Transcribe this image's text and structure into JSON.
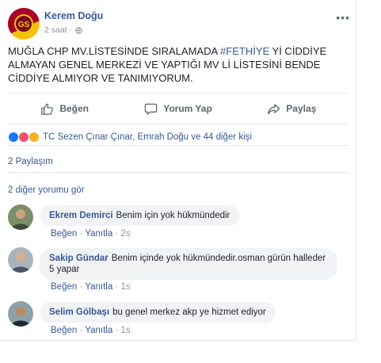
{
  "post": {
    "author": "Kerem Doğu",
    "time": "2 saat ·",
    "more": "•••",
    "text_before": "MUĞLA CHP MV.LİSTESİNDE SIRALAMADA ",
    "hashtag": "#FETHİYE",
    "text_after": " Yİ CİDDİYE ALMAYAN GENEL MERKEZİ VE YAPTIĞI MV Lİ LİSTESİNİ BENDE CİDDİYE ALMIYOR VE TANIMIYORUM."
  },
  "actions": {
    "like": "Beğen",
    "comment": "Yorum Yap",
    "share": "Paylaş"
  },
  "reactions": {
    "text": "TC Sezen Çınar Çınar, Emrah Doğu ve 44 diğer kişi"
  },
  "shares": "2 Paylaşım",
  "more_comments": "2 diğer yorumu gör",
  "comments": [
    {
      "author": "Ekrem Demirci",
      "text": "Benim için yok hükmündedir",
      "like": "Beğen",
      "reply": "Yanıtla",
      "time": "2s"
    },
    {
      "author": "Sakip Gündar",
      "text": "Benim içinde yok hükmündedir.osman gürün halleder 5 yapar",
      "like": "Beğen",
      "reply": "Yanıtla",
      "time": "1s"
    },
    {
      "author": "Selim Gölbaşı",
      "text": "bu genel merkez akp ye hizmet ediyor",
      "like": "Beğen",
      "reply": "Yanıtla",
      "time": "1s"
    }
  ],
  "separator": " · ",
  "colors": {
    "link": "#385898",
    "hashtag": "#365899",
    "bubble": "#f2f3f5",
    "muted": "#90949c",
    "like_reaction": "#1877f2",
    "love_reaction": "#f0506e",
    "wow_reaction": "#f7b125"
  },
  "icons": {
    "avatar": "galatasaray-logo-avatar",
    "privacy": "globe-icon",
    "like": "thumbs-up-icon",
    "comment": "speech-bubble-icon",
    "share": "share-arrow-icon"
  }
}
